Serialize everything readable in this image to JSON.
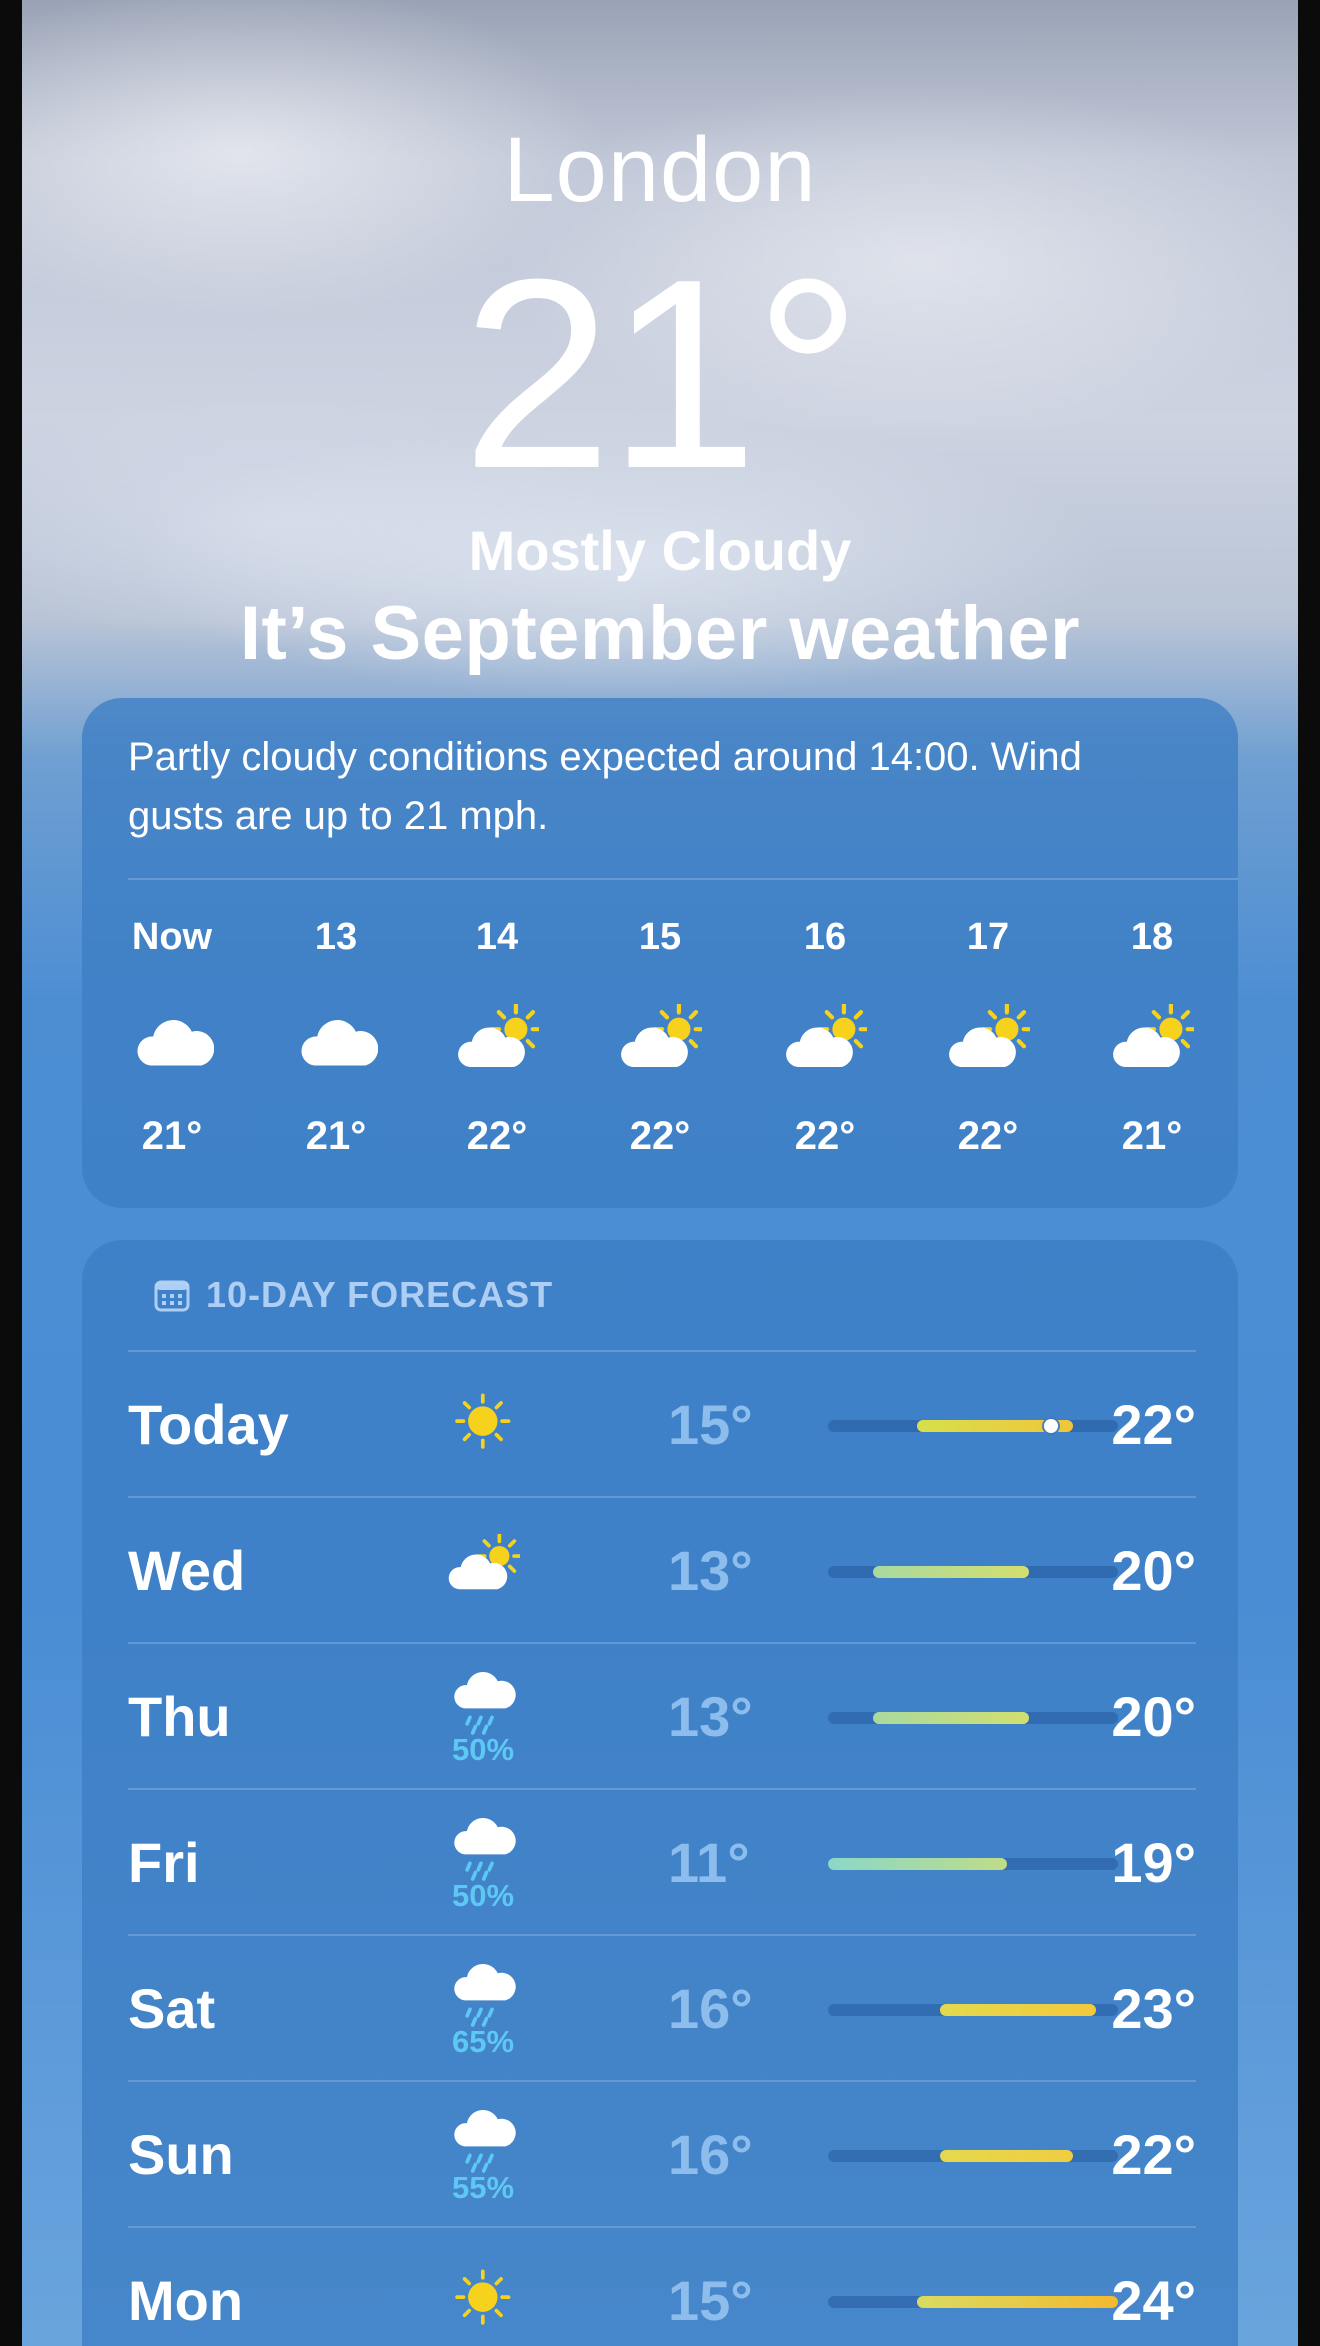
{
  "location": {
    "city": "London",
    "temperature": "21°",
    "condition": "Mostly Cloudy",
    "headline": "It’s September weather"
  },
  "hourly": {
    "summary": "Partly cloudy conditions expected around 14:00. Wind gusts are up to 21 mph.",
    "hours": [
      {
        "label": "Now",
        "icon": "cloud-icon",
        "temp": "21°"
      },
      {
        "label": "13",
        "icon": "cloud-icon",
        "temp": "21°"
      },
      {
        "label": "14",
        "icon": "partly-sunny-icon",
        "temp": "22°"
      },
      {
        "label": "15",
        "icon": "partly-sunny-icon",
        "temp": "22°"
      },
      {
        "label": "16",
        "icon": "partly-sunny-icon",
        "temp": "22°"
      },
      {
        "label": "17",
        "icon": "partly-sunny-icon",
        "temp": "22°"
      },
      {
        "label": "18",
        "icon": "partly-sunny-icon",
        "temp": "21°"
      }
    ]
  },
  "forecast": {
    "title": "10-DAY FORECAST",
    "title_icon": "calendar-icon",
    "range_low": 11,
    "range_high": 24,
    "current_temp": 21,
    "days": [
      {
        "day": "Today",
        "icon": "sun-icon",
        "precip": "",
        "low": "15°",
        "high": "22°",
        "low_val": 15,
        "high_val": 22,
        "colors": [
          "#d6e04a",
          "#f1c53a"
        ]
      },
      {
        "day": "Wed",
        "icon": "partly-sunny-icon",
        "precip": "",
        "low": "13°",
        "high": "20°",
        "low_val": 13,
        "high_val": 20,
        "colors": [
          "#a9d9a0",
          "#d3df6e"
        ]
      },
      {
        "day": "Thu",
        "icon": "rain-cloud-icon",
        "precip": "50%",
        "low": "13°",
        "high": "20°",
        "low_val": 13,
        "high_val": 20,
        "colors": [
          "#a9d9a0",
          "#d3df6e"
        ]
      },
      {
        "day": "Fri",
        "icon": "rain-cloud-icon",
        "precip": "50%",
        "low": "11°",
        "high": "19°",
        "low_val": 11,
        "high_val": 19,
        "colors": [
          "#8ad8c8",
          "#bfdc88"
        ]
      },
      {
        "day": "Sat",
        "icon": "rain-cloud-icon",
        "precip": "65%",
        "low": "16°",
        "high": "23°",
        "low_val": 16,
        "high_val": 23,
        "colors": [
          "#e4d94e",
          "#f2c93c"
        ]
      },
      {
        "day": "Sun",
        "icon": "rain-cloud-icon",
        "precip": "55%",
        "low": "16°",
        "high": "22°",
        "low_val": 16,
        "high_val": 22,
        "colors": [
          "#e4d94e",
          "#f0cd40"
        ]
      },
      {
        "day": "Mon",
        "icon": "sun-icon",
        "precip": "",
        "low": "15°",
        "high": "24°",
        "low_val": 15,
        "high_val": 24,
        "colors": [
          "#dadb62",
          "#f2b92e"
        ]
      }
    ]
  }
}
